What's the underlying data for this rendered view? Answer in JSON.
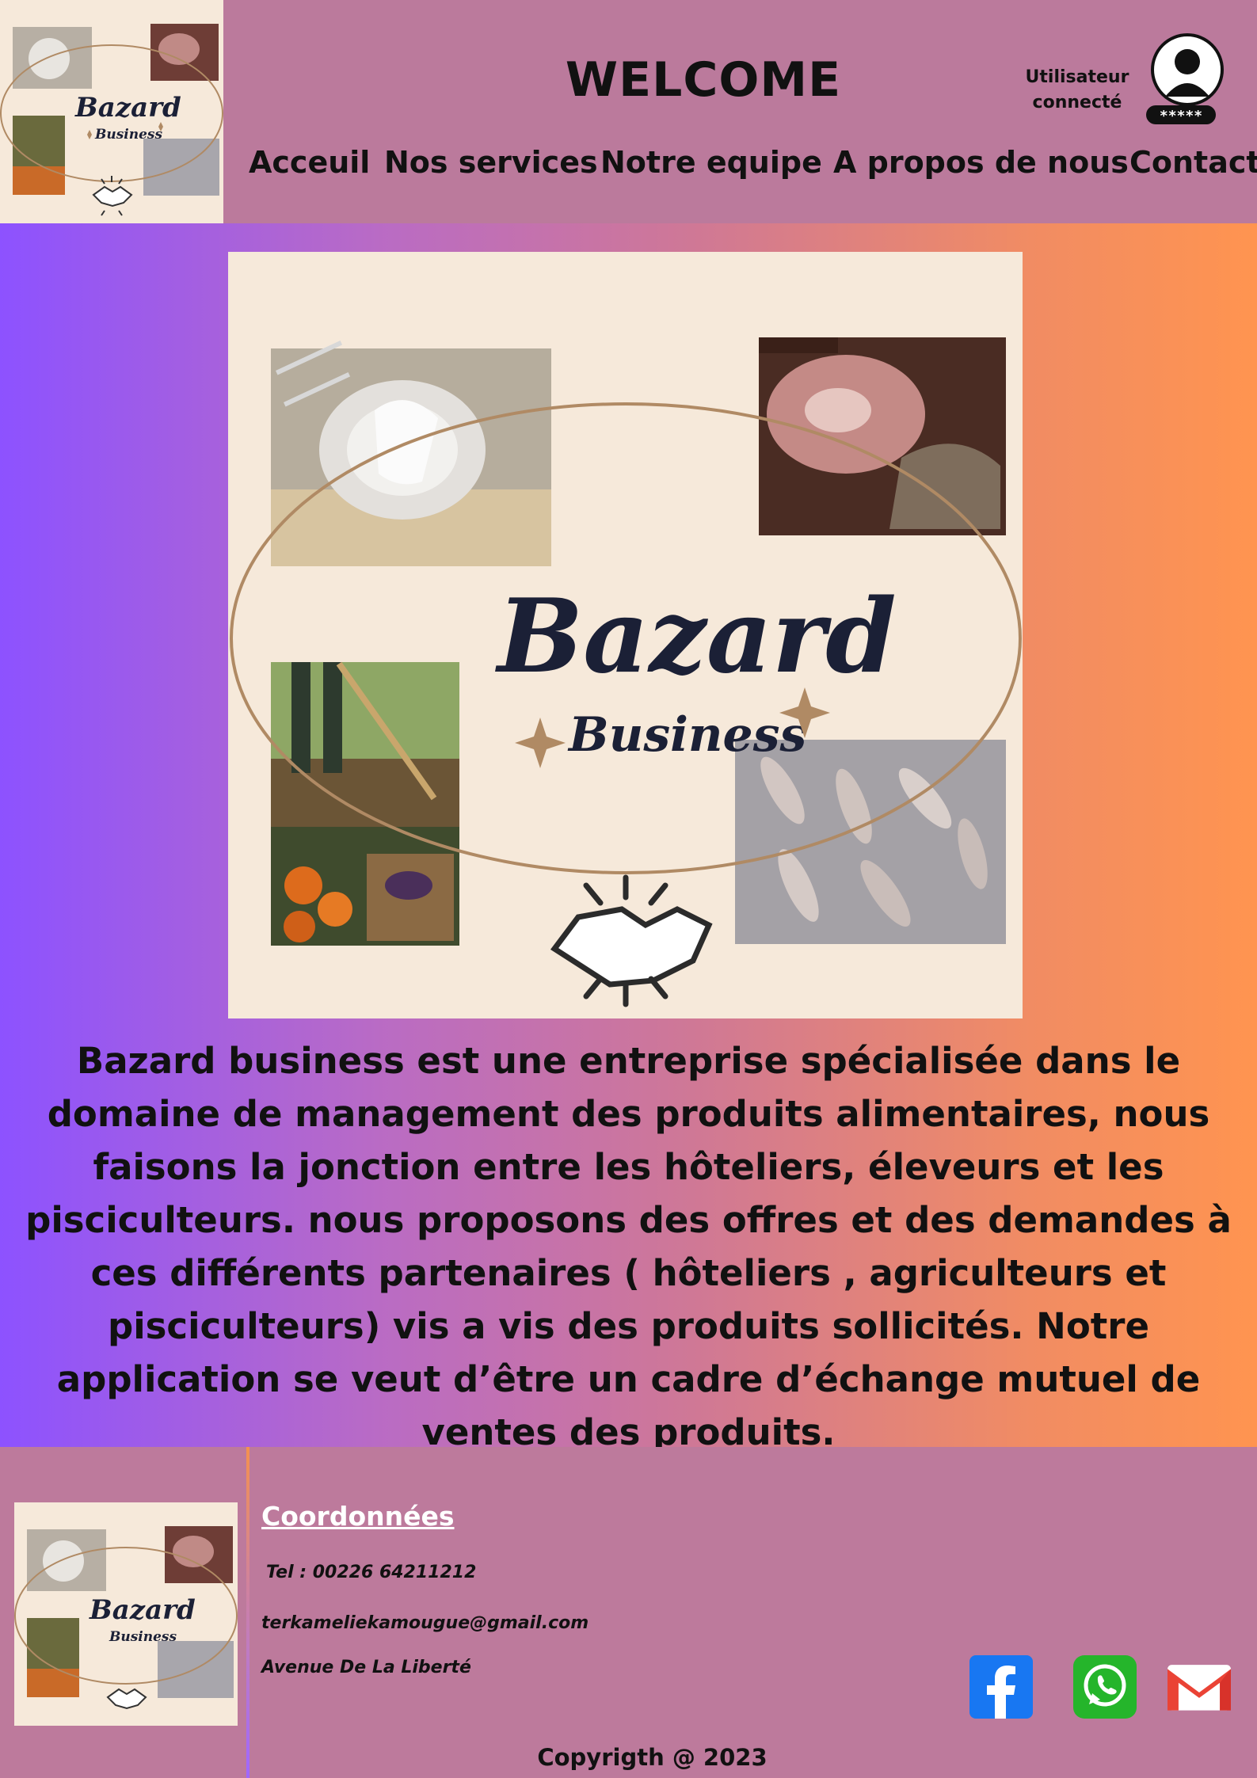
{
  "header": {
    "welcome": "WELCOME",
    "user_label_line1": "Utilisateur",
    "user_label_line2": "connecté",
    "user_password_mask": "*****",
    "logo_word1": "Bazard",
    "logo_word2": "Business"
  },
  "nav": {
    "items": [
      {
        "label": "Acceuil",
        "icon": null
      },
      {
        "label": "Nos services",
        "icon": null
      },
      {
        "label": "Notre equipe",
        "icon": null
      },
      {
        "label": "A propos de nous",
        "icon": null
      },
      {
        "label": "Contact",
        "icon": null
      }
    ]
  },
  "hero": {
    "brand_word1": "Bazard",
    "brand_word2": "Business",
    "description": "Bazard business est une entreprise spécialisée dans le domaine de management des produits alimentaires, nous faisons la jonction entre  les hôteliers,  éleveurs et les pisciculteurs. nous proposons des offres et des demandes à ces différents partenaires ( hôteliers , agriculteurs et pisciculteurs) vis a vis des produits sollicités. Notre application se veut d’être un cadre d’échange mutuel de ventes des produits."
  },
  "footer": {
    "coord_title": "Coordonnées",
    "tel": "Tel : 00226 64211212",
    "email": "terkameliekamougue@gmail.com",
    "address": "Avenue De La Liberté",
    "copyright": "Copyrigth @ 2023",
    "social": [
      {
        "icon": "facebook-icon",
        "color": "#1877f2"
      },
      {
        "icon": "whatsapp-icon",
        "color": "#25b52b"
      },
      {
        "icon": "gmail-icon",
        "color": "#ea4335"
      }
    ]
  },
  "colors": {
    "header_bg": "#bb7a9c",
    "gradient_start": "#8d52ff",
    "gradient_end": "#ff9450",
    "hero_bg": "#f6e9da",
    "brand_navy": "#1b2036"
  }
}
